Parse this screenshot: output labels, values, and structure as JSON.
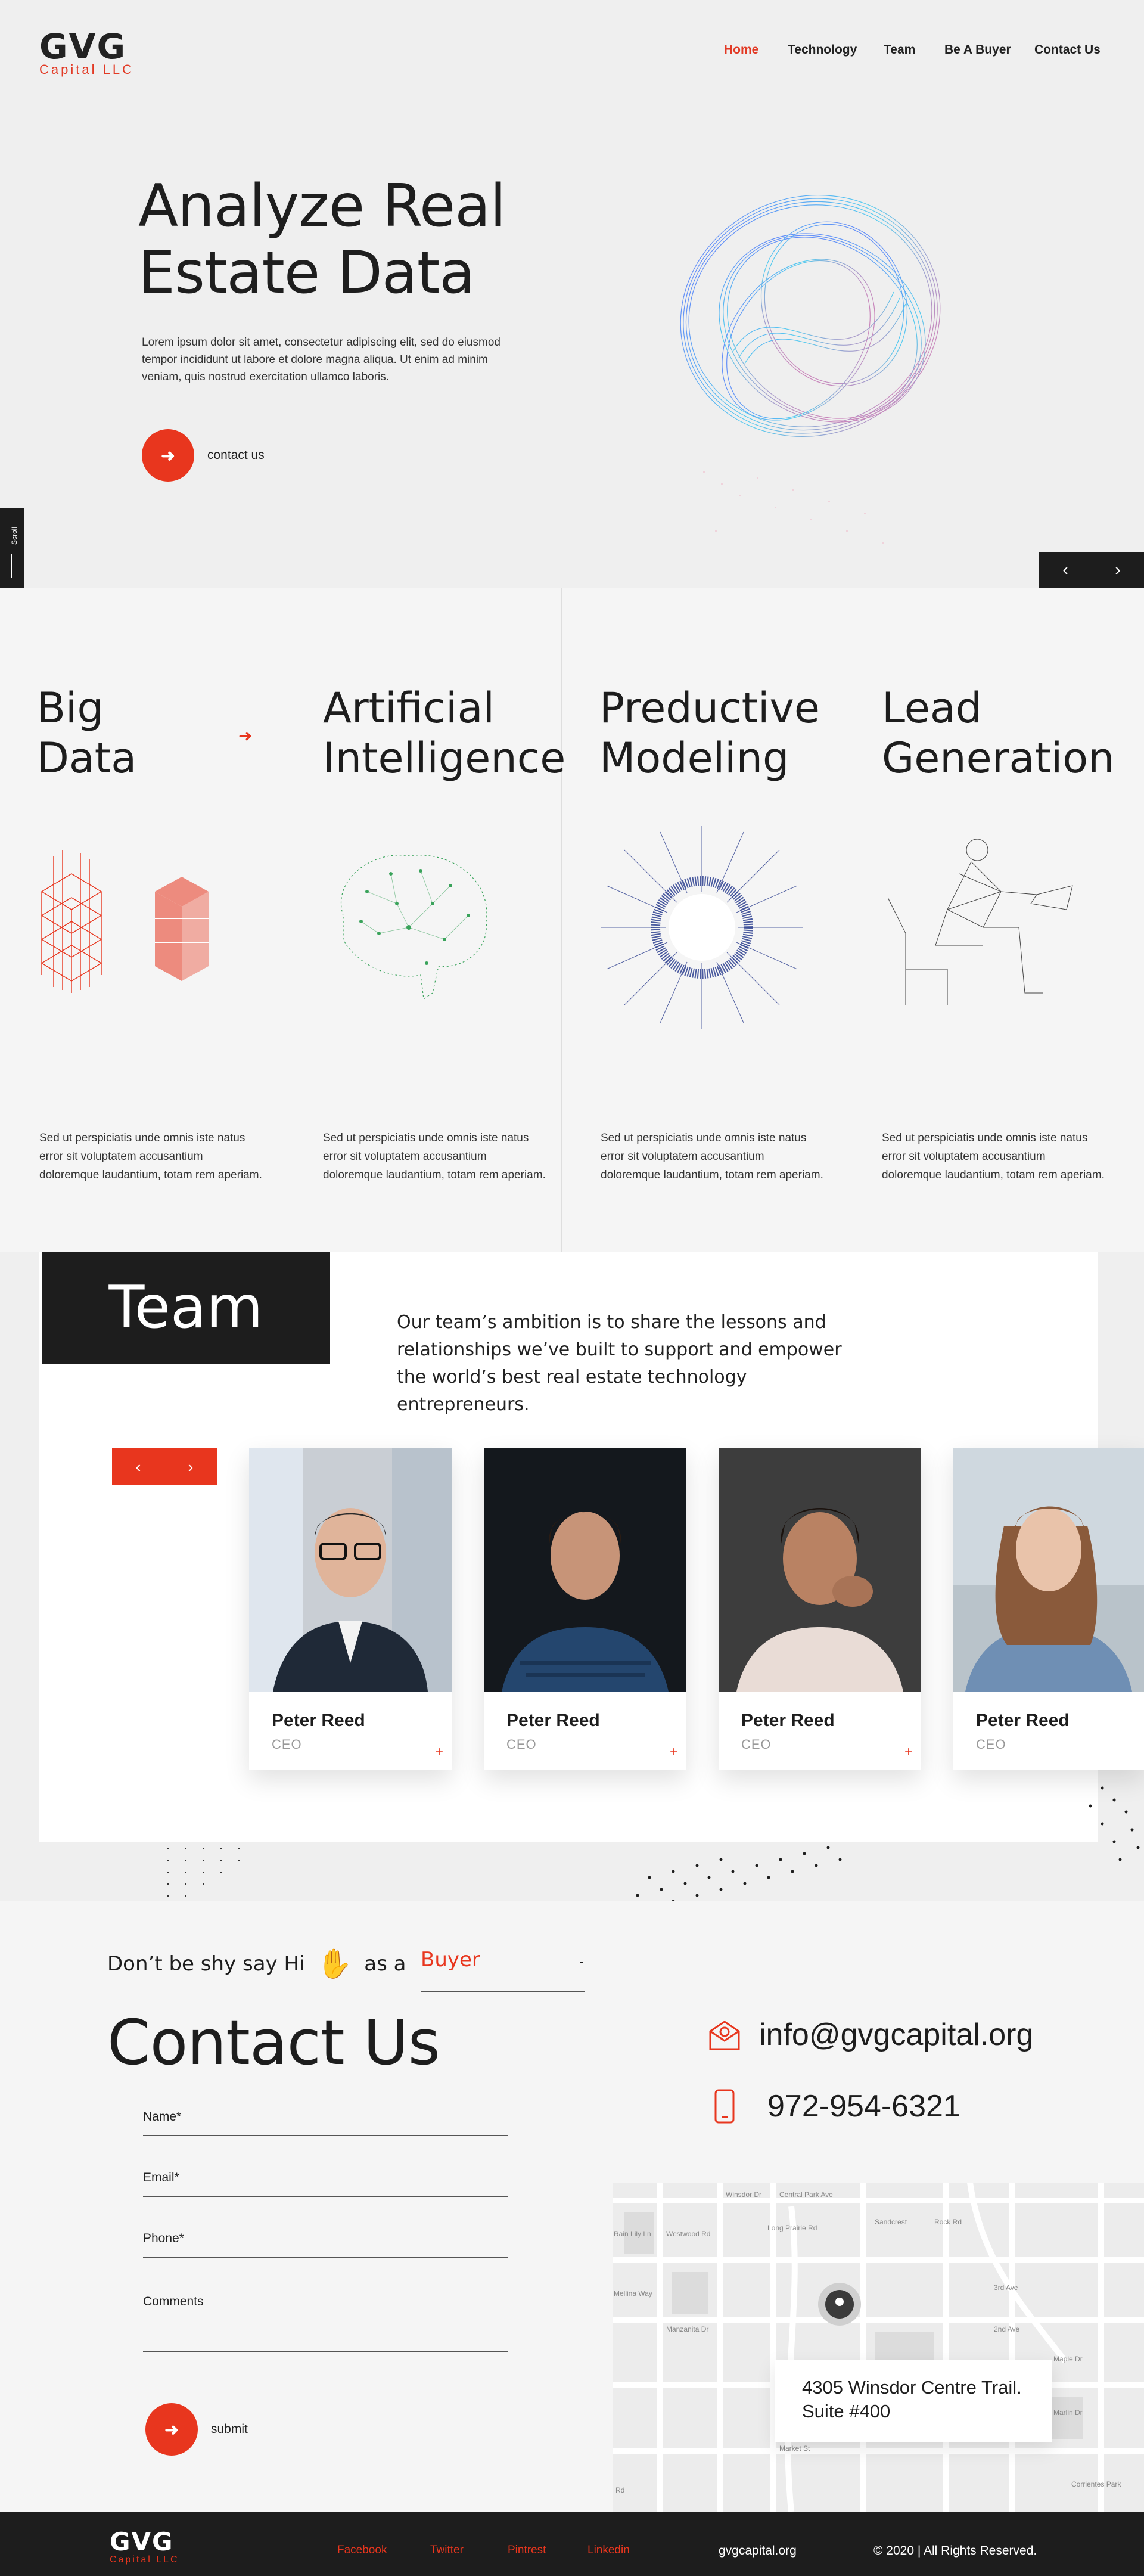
{
  "brand": {
    "logo_main": "GVG",
    "logo_sub": "Capital LLC"
  },
  "nav": {
    "items": [
      "Home",
      "Technology",
      "Team",
      "Be A Buyer",
      "Contact Us"
    ],
    "active": "Home"
  },
  "hero": {
    "title_line1": "Analyze Real",
    "title_line2": "Estate Data",
    "desc": "Lorem ipsum dolor sit amet, consectetur adipiscing elit, sed do eiusmod tempor incididunt ut labore et dolore magna aliqua. Ut enim ad minim veniam, quis nostrud exercitation ullamco laboris.",
    "cta_label": "contact us",
    "scroll_label": "Scroll"
  },
  "services": [
    {
      "line1": "Big",
      "line2": "Data",
      "desc": "Sed ut perspiciatis unde omnis iste natus error sit voluptatem accusantium doloremque laudantium, totam rem aperiam."
    },
    {
      "line1": "Artificial",
      "line2": "Intelligence",
      "desc": "Sed ut perspiciatis unde omnis iste natus error sit voluptatem accusantium doloremque laudantium, totam rem aperiam."
    },
    {
      "line1": "Preductive",
      "line2": "Modeling",
      "desc": "Sed ut perspiciatis unde omnis iste natus error sit voluptatem accusantium doloremque laudantium, totam rem aperiam."
    },
    {
      "line1": "Lead",
      "line2": "Generation",
      "desc": "Sed ut perspiciatis unde omnis iste natus error sit voluptatem accusantium doloremque laudantium, totam rem aperiam."
    }
  ],
  "team": {
    "heading": "Team",
    "desc": "Our team’s ambition is to share the lessons and relationships we’ve built to support and empower the world’s best real estate technology entrepreneurs.",
    "members": [
      {
        "name": "Peter Reed",
        "role": "CEO"
      },
      {
        "name": "Peter Reed",
        "role": "CEO"
      },
      {
        "name": "Peter Reed",
        "role": "CEO"
      },
      {
        "name": "Peter Reed",
        "role": "CEO"
      }
    ]
  },
  "contact": {
    "hi_text": "Don’t be shy say Hi",
    "as_a": "as a",
    "role_value": "Buyer",
    "heading": "Contact Us",
    "fields": {
      "name": "Name*",
      "email": "Email*",
      "phone": "Phone*",
      "comments": "Comments"
    },
    "submit_label": "submit",
    "email": "info@gvgcapital.org",
    "phone": "972-954-6321",
    "address_line1": "4305 Winsdor Centre Trail.",
    "address_line2": "Suite #400",
    "map_labels": [
      "Winsdor Dr",
      "Central Park Ave",
      "Rain Lily Ln",
      "Mellina Way",
      "Westwood Rd",
      "Manzanita Dr",
      "Long Prairie Rd",
      "Rd",
      "Sandcrest",
      "Rock Rd",
      "3rd Ave",
      "2nd Ave",
      "Maple Dr",
      "Marlin Dr",
      "Market St",
      "Corrientes Park"
    ]
  },
  "footer": {
    "links": [
      "Facebook",
      "Twitter",
      "Pintrest",
      "Linkedin"
    ],
    "site": "gvgcapital.org",
    "copyright": "© 2020 | All Rights Reserved."
  },
  "colors": {
    "accent": "#e8361e",
    "dark": "#1d1d1d",
    "background": "#efefef"
  }
}
